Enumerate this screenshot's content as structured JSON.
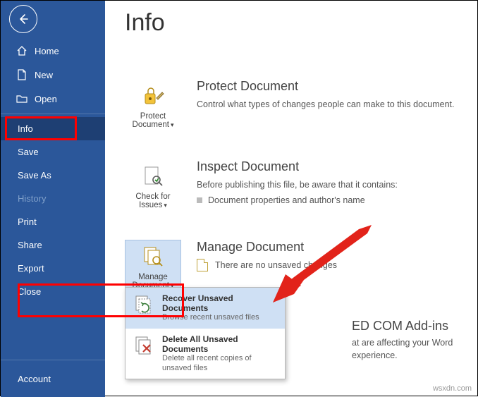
{
  "sidebar": {
    "items": [
      {
        "label": "Home"
      },
      {
        "label": "New"
      },
      {
        "label": "Open"
      },
      {
        "label": "Info"
      },
      {
        "label": "Save"
      },
      {
        "label": "Save As"
      },
      {
        "label": "History"
      },
      {
        "label": "Print"
      },
      {
        "label": "Share"
      },
      {
        "label": "Export"
      },
      {
        "label": "Close"
      }
    ],
    "account": "Account"
  },
  "page": {
    "title": "Info"
  },
  "protect": {
    "btn": "Protect Document",
    "title": "Protect Document",
    "desc": "Control what types of changes people can make to this document."
  },
  "inspect": {
    "btn": "Check for Issues",
    "title": "Inspect Document",
    "desc": "Before publishing this file, be aware that it contains:",
    "bullet": "Document properties and author's name"
  },
  "manage": {
    "btn": "Manage Document",
    "title": "Manage Document",
    "desc": "There are no unsaved changes"
  },
  "dropdown": {
    "recover": {
      "title": "Recover Unsaved Documents",
      "sub": "Browse recent unsaved files"
    },
    "delete": {
      "title": "Delete All Unsaved Documents",
      "sub": "Delete all recent copies of unsaved files"
    }
  },
  "com": {
    "title_frag": "ED COM Add-ins",
    "desc_frag": "at are affecting your Word experience."
  },
  "watermark": "wsxdn.com"
}
